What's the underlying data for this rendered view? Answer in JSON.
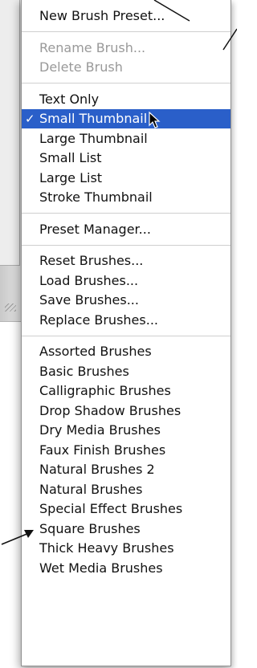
{
  "menu": {
    "groups": [
      [
        {
          "label": "New Brush Preset...",
          "enabled": true
        }
      ],
      [
        {
          "label": "Rename Brush...",
          "enabled": false
        },
        {
          "label": "Delete Brush",
          "enabled": false
        }
      ],
      [
        {
          "label": "Text Only",
          "enabled": true
        },
        {
          "label": "Small Thumbnail",
          "enabled": true,
          "checked": true,
          "highlighted": true
        },
        {
          "label": "Large Thumbnail",
          "enabled": true
        },
        {
          "label": "Small List",
          "enabled": true
        },
        {
          "label": "Large List",
          "enabled": true
        },
        {
          "label": "Stroke Thumbnail",
          "enabled": true
        }
      ],
      [
        {
          "label": "Preset Manager...",
          "enabled": true
        }
      ],
      [
        {
          "label": "Reset Brushes...",
          "enabled": true
        },
        {
          "label": "Load Brushes...",
          "enabled": true
        },
        {
          "label": "Save Brushes...",
          "enabled": true
        },
        {
          "label": "Replace Brushes...",
          "enabled": true
        }
      ],
      [
        {
          "label": "Assorted Brushes",
          "enabled": true
        },
        {
          "label": "Basic Brushes",
          "enabled": true
        },
        {
          "label": "Calligraphic Brushes",
          "enabled": true
        },
        {
          "label": "Drop Shadow Brushes",
          "enabled": true
        },
        {
          "label": "Dry Media Brushes",
          "enabled": true
        },
        {
          "label": "Faux Finish Brushes",
          "enabled": true
        },
        {
          "label": "Natural Brushes 2",
          "enabled": true
        },
        {
          "label": "Natural Brushes",
          "enabled": true
        },
        {
          "label": "Special Effect Brushes",
          "enabled": true
        },
        {
          "label": "Square Brushes",
          "enabled": true
        },
        {
          "label": "Thick Heavy Brushes",
          "enabled": true
        },
        {
          "label": "Wet Media Brushes",
          "enabled": true
        }
      ]
    ],
    "check_glyph": "✓",
    "highlight_color": "#2a5fc9"
  },
  "icons": {
    "pointer": "arrow-cursor-icon"
  }
}
